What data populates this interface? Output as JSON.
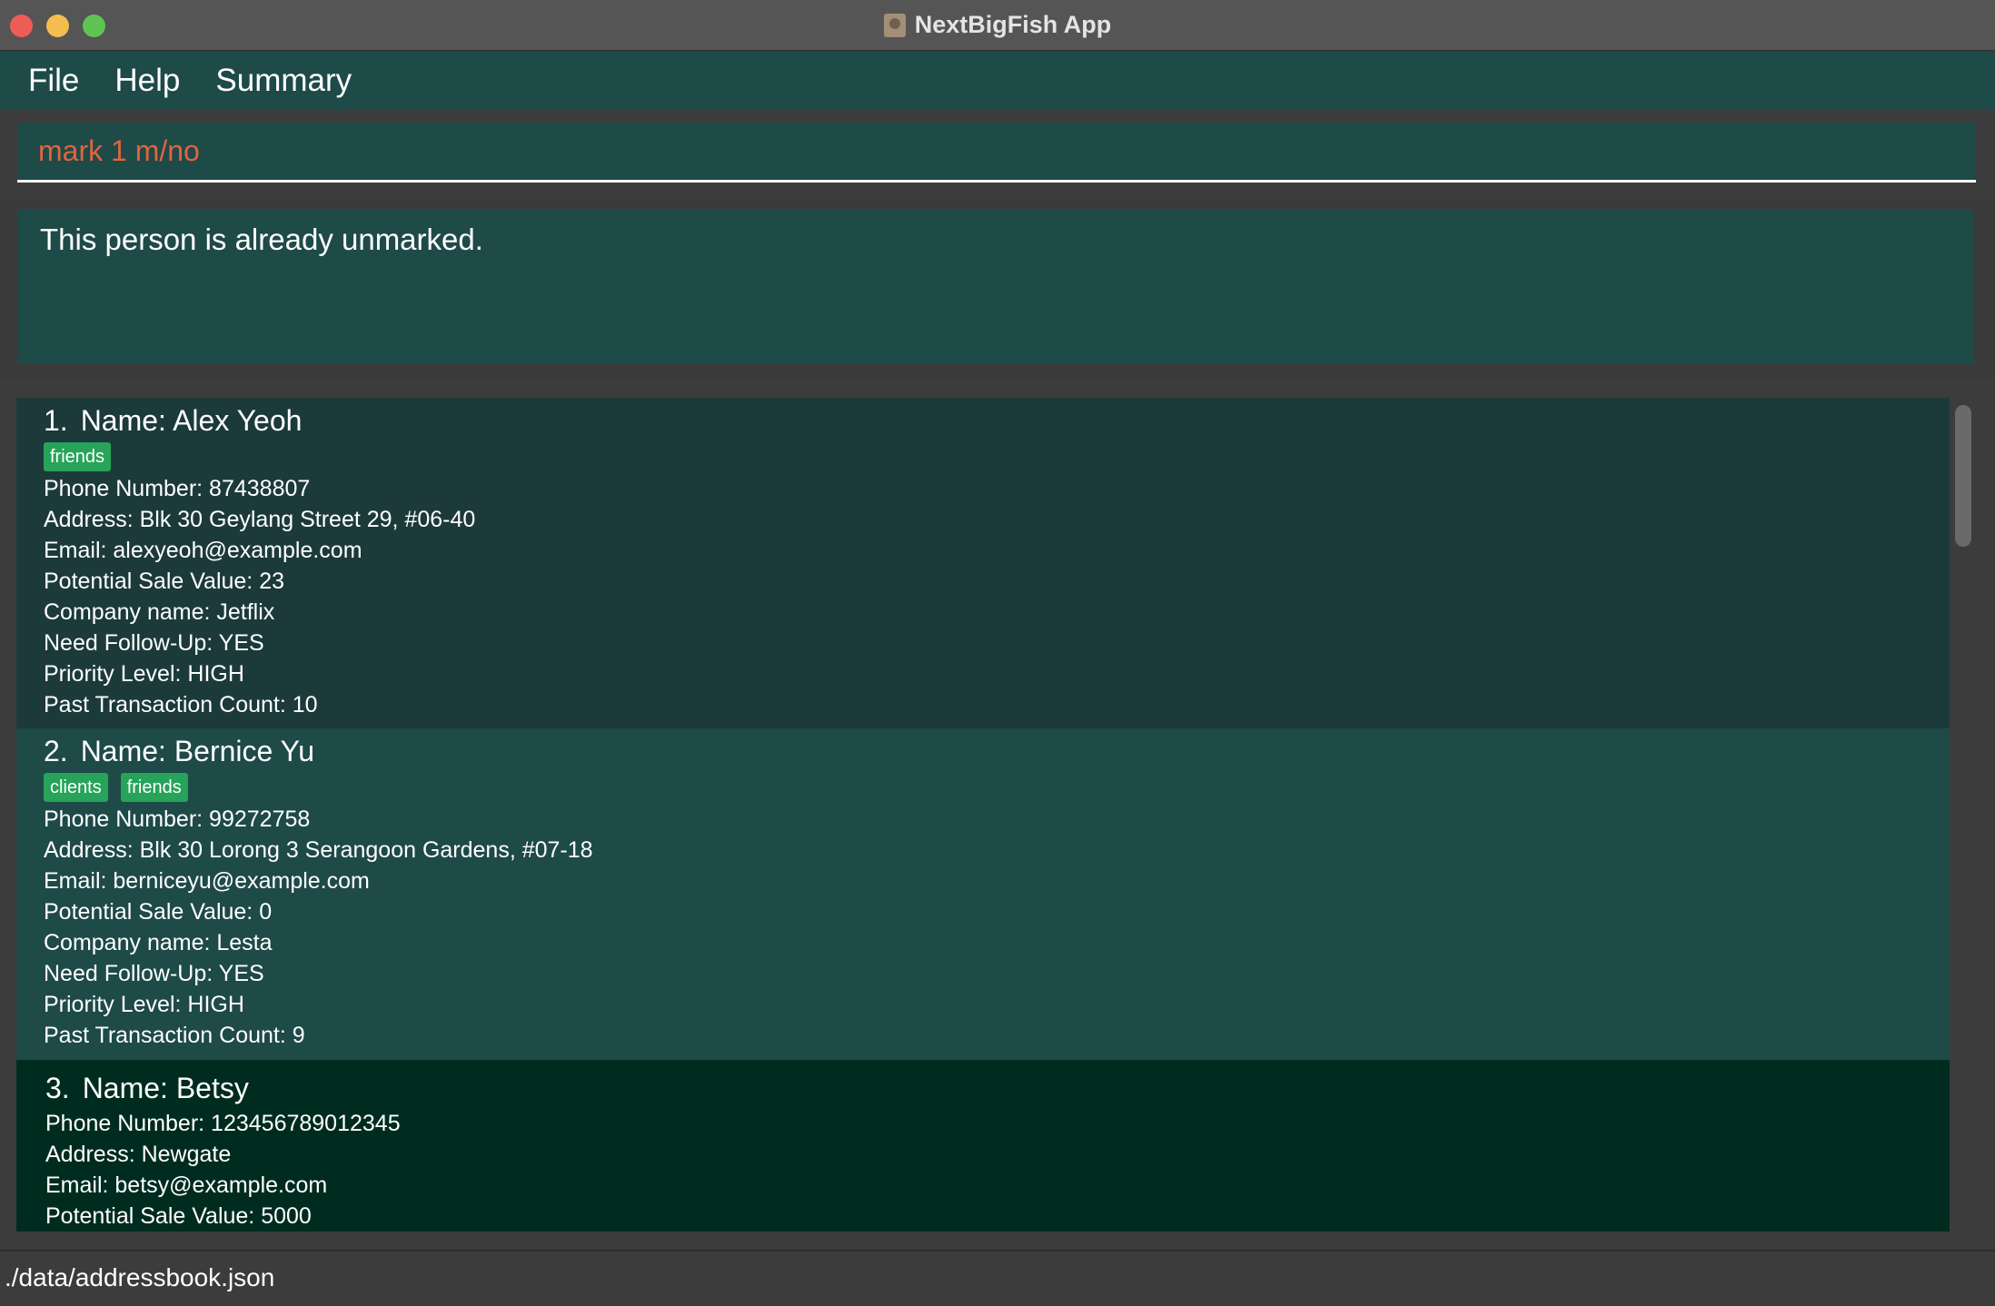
{
  "window": {
    "title": "NextBigFish App"
  },
  "menu": {
    "items": [
      "File",
      "Help",
      "Summary"
    ]
  },
  "command": {
    "value": "mark 1 m/no"
  },
  "result": {
    "message": "This person is already unmarked."
  },
  "persons": [
    {
      "index": "1.",
      "name": "Name: Alex Yeoh",
      "tags": [
        "friends"
      ],
      "fields": [
        "Phone Number: 87438807",
        "Address: Blk 30 Geylang Street 29, #06-40",
        "Email: alexyeoh@example.com",
        "Potential Sale Value: 23",
        "Company name: Jetflix",
        "Need Follow-Up: YES",
        "Priority Level: HIGH",
        "Past Transaction Count: 10"
      ]
    },
    {
      "index": "2.",
      "name": "Name: Bernice Yu",
      "tags": [
        "clients",
        "friends"
      ],
      "fields": [
        "Phone Number: 99272758",
        "Address: Blk 30 Lorong 3 Serangoon Gardens, #07-18",
        "Email: berniceyu@example.com",
        "Potential Sale Value: 0",
        "Company name: Lesta",
        "Need Follow-Up: YES",
        "Priority Level: HIGH",
        "Past Transaction Count: 9"
      ]
    },
    {
      "index": "3.",
      "name": "Name: Betsy",
      "tags": [],
      "fields": [
        "Phone Number: 123456789012345",
        "Address: Newgate",
        "Email: betsy@example.com",
        "Potential Sale Value: 5000"
      ]
    }
  ],
  "status": {
    "path": "./data/addressbook.json"
  },
  "colors": {
    "panel": "#1e4a48",
    "selected_card": "#1c3a3a",
    "highlight_card": "#002c20",
    "tag": "#27a35a",
    "command_text": "#e2643f"
  }
}
